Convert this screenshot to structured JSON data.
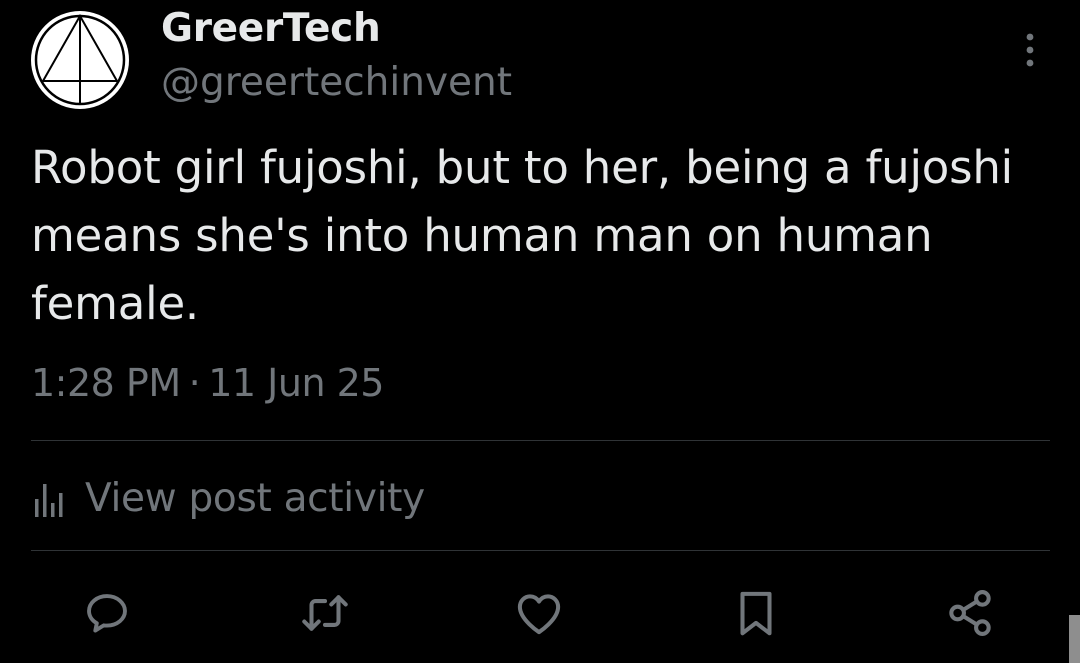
{
  "post": {
    "author": {
      "display_name": "GreerTech",
      "handle": "@greertechinvent",
      "avatar_icon": "triangle-in-circle-logo"
    },
    "text": "Robot girl fujoshi, but to her, being a fujoshi means she's into human man on human female.",
    "time": "1:28 PM",
    "separator": "·",
    "date": "11 Jun 25"
  },
  "activity": {
    "label": "View post activity",
    "icon": "bar-chart-icon"
  },
  "actions": [
    {
      "name": "reply",
      "icon": "speech-bubble-icon"
    },
    {
      "name": "repost",
      "icon": "repost-arrows-icon"
    },
    {
      "name": "like",
      "icon": "heart-icon"
    },
    {
      "name": "bookmark",
      "icon": "bookmark-icon"
    },
    {
      "name": "share",
      "icon": "share-nodes-icon"
    }
  ],
  "colors": {
    "background": "#000000",
    "primary_text": "#e7e9ea",
    "secondary_text": "#71767b",
    "divider": "#2f3336"
  }
}
